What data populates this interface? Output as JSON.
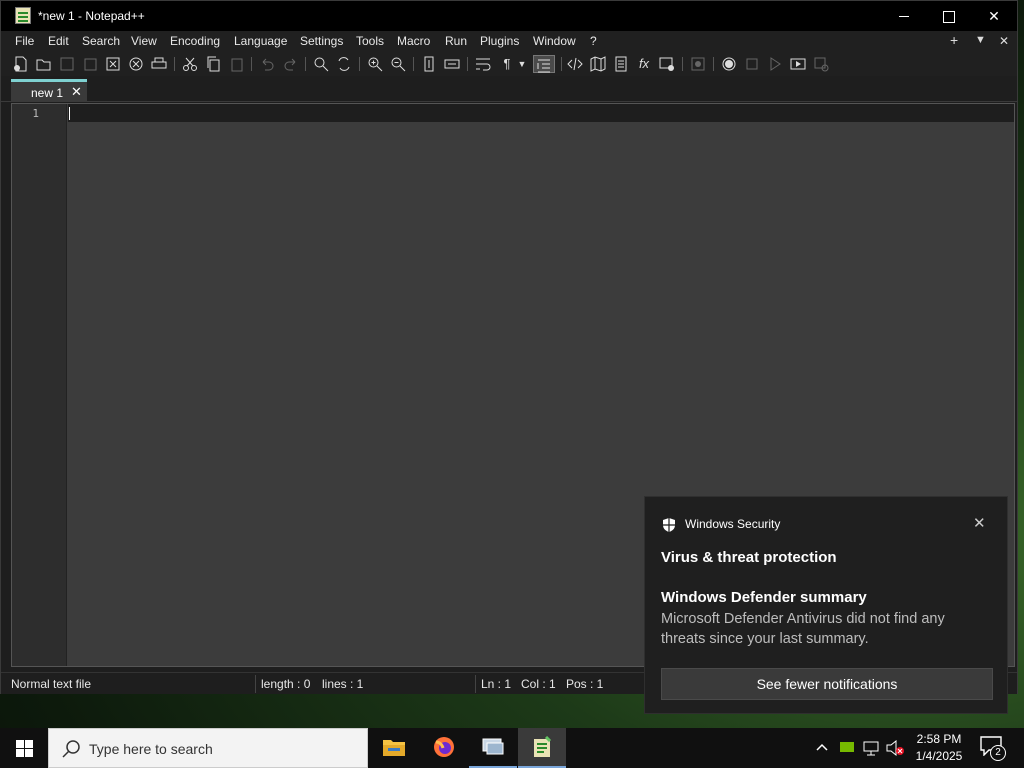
{
  "window": {
    "title": "*new 1 - Notepad++",
    "controls": {
      "minimize": "",
      "maximize": "",
      "close": "✕"
    }
  },
  "menu": {
    "items": [
      "File",
      "Edit",
      "Search",
      "View",
      "Encoding",
      "Language",
      "Settings",
      "Tools",
      "Macro",
      "Run",
      "Plugins",
      "Window",
      "?"
    ],
    "right": {
      "plus": "+",
      "dropdown": "▼",
      "close": "✕"
    }
  },
  "toolbar": {
    "icons": [
      "new-file-icon",
      "open-file-icon",
      "save-icon",
      "save-all-icon",
      "close-icon",
      "close-all-icon",
      "print-icon",
      "cut-icon",
      "copy-icon",
      "paste-icon",
      "undo-icon",
      "redo-icon",
      "find-icon",
      "replace-icon",
      "zoom-in-icon",
      "zoom-out-icon",
      "sync-vertical-icon",
      "sync-horizontal-icon",
      "word-wrap-icon",
      "show-all-chars-icon",
      "indent-guide-icon",
      "xml-icon",
      "document-map-icon",
      "doc-list-icon",
      "function-list-icon",
      "monitoring-icon",
      "record-macro-icon",
      "stop-macro-icon",
      "play-macro-icon",
      "run-macro-multiple-icon",
      "save-macro-icon"
    ]
  },
  "tabs": [
    {
      "label": "new 1",
      "close": "✕",
      "active": true
    }
  ],
  "editor": {
    "line_numbers": [
      "1"
    ],
    "content": ""
  },
  "status": {
    "file_type": "Normal text file",
    "length": "length : 0",
    "lines": "lines : 1",
    "ln": "Ln : 1",
    "col": "Col : 1",
    "pos": "Pos : 1"
  },
  "toast": {
    "app": "Windows Security",
    "close": "✕",
    "heading": "Virus & threat protection",
    "summary_title": "Windows Defender summary",
    "body": "Microsoft Defender Antivirus did not find any threats since your last summary.",
    "button": "See fewer notifications"
  },
  "taskbar": {
    "search_placeholder": "Type here to search",
    "apps": [
      "file-explorer-icon",
      "firefox-icon",
      "remote-desktop-icon",
      "notepad-plus-plus-icon"
    ],
    "clock": {
      "time": "2:58 PM",
      "date": "1/4/2025"
    },
    "notification_count": "2"
  },
  "colors": {
    "accent_tab": "#7fd1d1",
    "editor_bg": "#3c3c3c",
    "titlebar_bg": "#000000"
  }
}
